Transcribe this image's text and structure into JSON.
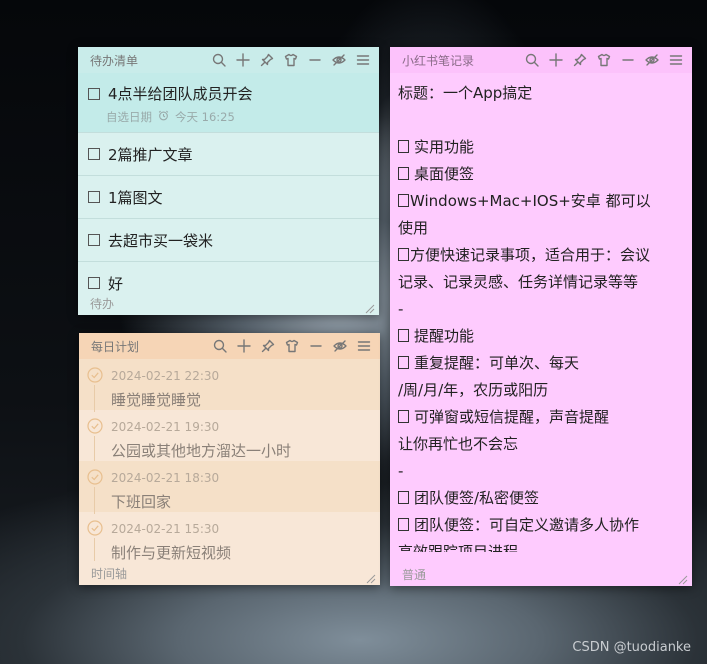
{
  "todo_note": {
    "title": "待办清单",
    "footer": "待办",
    "color": "#daf1ef",
    "items": [
      {
        "text": "4点半给团队成员开会",
        "date_label": "自选日期",
        "reminder": "今天 16:25"
      },
      {
        "text": "2篇推广文章"
      },
      {
        "text": "1篇图文"
      },
      {
        "text": "去超市买一袋米"
      },
      {
        "text": "好"
      }
    ]
  },
  "plan_note": {
    "title": "每日计划",
    "footer": "时间轴",
    "color": "#f8e7d7",
    "entries": [
      {
        "date": "2024-02-21 22:30",
        "text": "睡觉睡觉睡觉"
      },
      {
        "date": "2024-02-21 19:30",
        "text": "公园或其他地方溜达一小时"
      },
      {
        "date": "2024-02-21 18:30",
        "text": "下班回家"
      },
      {
        "date": "2024-02-21 15:30",
        "text": "制作与更新短视频"
      }
    ]
  },
  "xhs_note": {
    "title": "小红书笔记录",
    "footer": "普通",
    "color": "#fecbfe",
    "lines": [
      {
        "text": "标题：一个App搞定"
      },
      {
        "text": ""
      },
      {
        "text": "实用功能",
        "mark": true
      },
      {
        "text": "桌面便签",
        "mark": true
      },
      {
        "text": "Windows+Mac+IOS+安卓 都可以",
        "mark": true,
        "tight": true
      },
      {
        "text": "使用"
      },
      {
        "text": "方便快速记录事项，适合用于：会议",
        "mark": true,
        "tight": true
      },
      {
        "text": "记录、记录灵感、任务详情记录等等"
      },
      {
        "text": "-"
      },
      {
        "text": "提醒功能",
        "mark": true
      },
      {
        "text": "重复提醒：可单次、每天",
        "mark": true
      },
      {
        "text": "/周/月/年，农历或阳历"
      },
      {
        "text": "可弹窗或短信提醒，声音提醒",
        "mark": true
      },
      {
        "text": "让你再忙也不会忘"
      },
      {
        "text": "-"
      },
      {
        "text": "团队便签/私密便签",
        "mark": true
      },
      {
        "text": "团队便签：可自定义邀请多人协作",
        "mark": true
      },
      {
        "text": "高效跟踪项目进程"
      }
    ]
  },
  "toolbar_icons": [
    "search-icon",
    "plus-icon",
    "pin-icon",
    "shirt-icon",
    "minimize-icon",
    "hide-eye-icon",
    "menu-icon"
  ],
  "watermark": "CSDN @tuodianke"
}
